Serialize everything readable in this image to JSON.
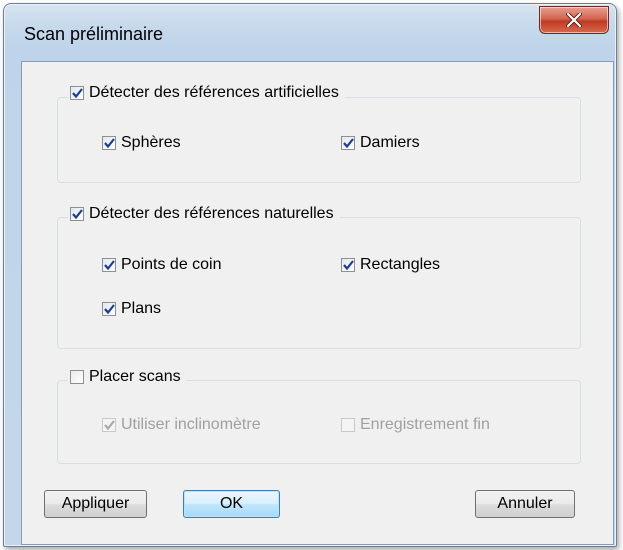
{
  "window": {
    "title": "Scan préliminaire",
    "close_icon": "close-icon"
  },
  "groups": {
    "artificial": {
      "label": "Détecter des références artificielles",
      "checked": true,
      "options": {
        "spheres": {
          "label": "Sphères",
          "checked": true
        },
        "damiers": {
          "label": "Damiers",
          "checked": true
        }
      }
    },
    "natural": {
      "label": "Détecter des références naturelles",
      "checked": true,
      "options": {
        "corners": {
          "label": "Points de coin",
          "checked": true
        },
        "rectangles": {
          "label": "Rectangles",
          "checked": true
        },
        "plans": {
          "label": "Plans",
          "checked": true
        }
      }
    },
    "place": {
      "label": "Placer scans",
      "checked": false,
      "options": {
        "inclinometer": {
          "label": "Utiliser inclinomètre",
          "checked": true,
          "disabled": true
        },
        "fine": {
          "label": "Enregistrement fin",
          "checked": false,
          "disabled": true
        }
      }
    }
  },
  "buttons": {
    "apply": "Appliquer",
    "ok": "OK",
    "cancel": "Annuler"
  },
  "colors": {
    "check": "#1f3c8a",
    "check_disabled": "#a8a8a8",
    "close_bg": "#c7402a"
  }
}
